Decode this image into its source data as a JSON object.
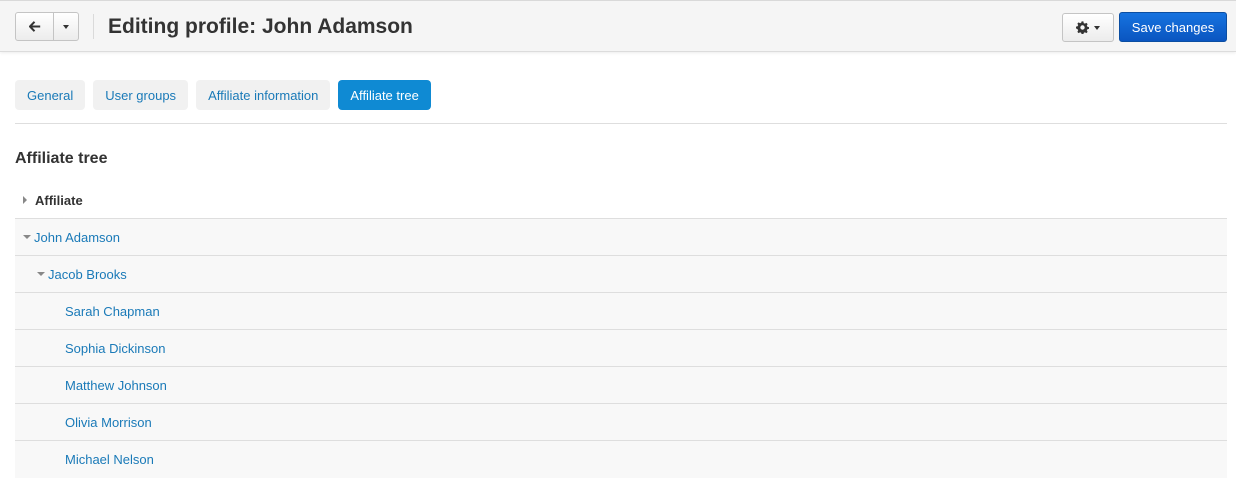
{
  "header": {
    "title": "Editing profile: John Adamson",
    "save_label": "Save changes",
    "back_icon": "arrow-left-icon",
    "settings_icon": "gear-icon"
  },
  "tabs": [
    {
      "label": "General",
      "active": false
    },
    {
      "label": "User groups",
      "active": false
    },
    {
      "label": "Affiliate information",
      "active": false
    },
    {
      "label": "Affiliate tree",
      "active": true
    }
  ],
  "section": {
    "title": "Affiliate tree"
  },
  "tree": {
    "column_header": "Affiliate",
    "nodes": [
      {
        "name": "John Adamson",
        "expanded": true
      },
      {
        "name": "Jacob Brooks",
        "expanded": true
      },
      {
        "name": "Sarah Chapman"
      },
      {
        "name": "Sophia Dickinson"
      },
      {
        "name": "Matthew Johnson"
      },
      {
        "name": "Olivia Morrison"
      },
      {
        "name": "Michael Nelson"
      }
    ]
  },
  "colors": {
    "accent": "#0f8ad3",
    "primary_button": "#0a60c8",
    "link": "#1a7ab8"
  }
}
